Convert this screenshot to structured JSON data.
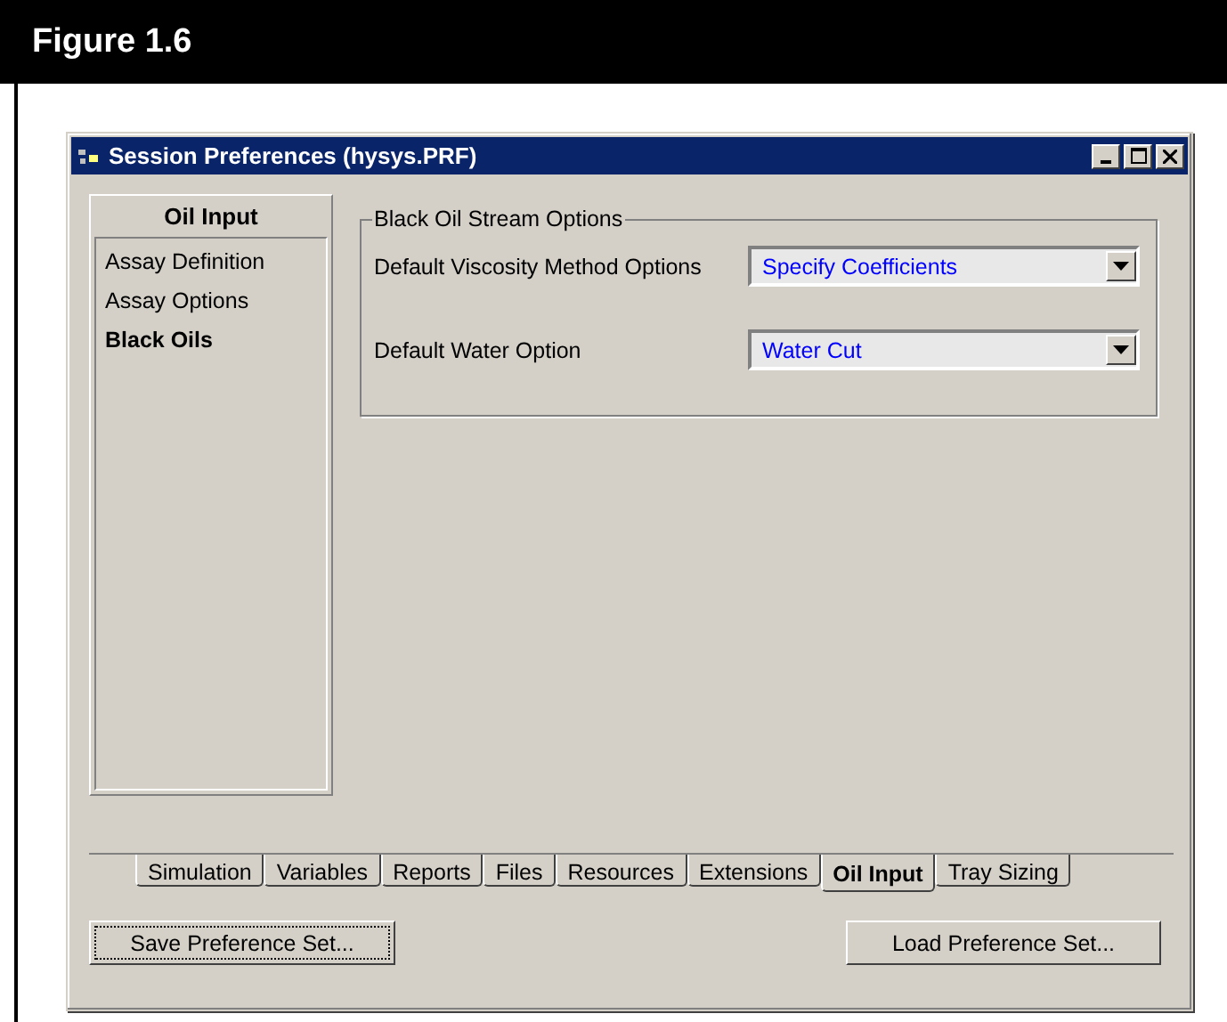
{
  "figure": {
    "title": "Figure 1.6"
  },
  "window": {
    "title": "Session Preferences (hysys.PRF)"
  },
  "sidebar": {
    "title": "Oil Input",
    "items": [
      {
        "label": "Assay Definition",
        "selected": false
      },
      {
        "label": "Assay Options",
        "selected": false
      },
      {
        "label": "Black Oils",
        "selected": true
      }
    ]
  },
  "group": {
    "title": "Black Oil Stream Options",
    "fields": [
      {
        "label": "Default Viscosity Method Options",
        "value": "Specify Coefficients"
      },
      {
        "label": "Default Water Option",
        "value": "Water Cut"
      }
    ]
  },
  "tabs": [
    {
      "label": "Simulation",
      "selected": false
    },
    {
      "label": "Variables",
      "selected": false
    },
    {
      "label": "Reports",
      "selected": false
    },
    {
      "label": "Files",
      "selected": false
    },
    {
      "label": "Resources",
      "selected": false
    },
    {
      "label": "Extensions",
      "selected": false
    },
    {
      "label": "Oil Input",
      "selected": true
    },
    {
      "label": "Tray Sizing",
      "selected": false
    }
  ],
  "buttons": [
    {
      "label": "Save Preference Set...",
      "focused": true
    },
    {
      "label": "Load Preference Set...",
      "focused": false
    }
  ]
}
